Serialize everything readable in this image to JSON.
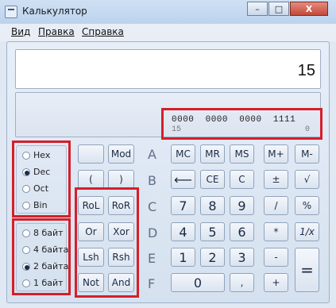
{
  "window": {
    "title": "Калькулятор",
    "buttons": {
      "minimize": "–",
      "maximize": "□",
      "close": "X"
    }
  },
  "menu": {
    "items": [
      "Вид",
      "Правка",
      "Справка"
    ]
  },
  "display": {
    "value": "15",
    "bits": {
      "row1": "0000  0000  0000  1111",
      "row2_left": "15",
      "row2_right": "0"
    }
  },
  "radix": {
    "options": [
      "Hex",
      "Dec",
      "Oct",
      "Bin"
    ],
    "selected": "Dec"
  },
  "word_size": {
    "options": [
      "8 байт",
      "4 байта",
      "2 байта",
      "1 байт"
    ],
    "selected": "2 байта"
  },
  "keys": {
    "blank": "",
    "mod": "Mod",
    "open_paren": "(",
    "close_paren": ")",
    "rol": "RoL",
    "ror": "RoR",
    "or": "Or",
    "xor": "Xor",
    "lsh": "Lsh",
    "rsh": "Rsh",
    "not": "Not",
    "and": "And",
    "hex_a": "A",
    "hex_b": "B",
    "hex_c": "C",
    "hex_d": "D",
    "hex_e": "E",
    "hex_f": "F",
    "mc": "MC",
    "mr": "MR",
    "ms": "MS",
    "mplus": "M+",
    "mminus": "M-",
    "backspace": "⟵",
    "ce": "CE",
    "c": "C",
    "plusminus": "±",
    "sqrt": "√",
    "n7": "7",
    "n8": "8",
    "n9": "9",
    "div": "/",
    "percent": "%",
    "n4": "4",
    "n5": "5",
    "n6": "6",
    "mul": "*",
    "inv": "1/x",
    "n1": "1",
    "n2": "2",
    "n3": "3",
    "sub": "-",
    "n0": "0",
    "dot": ",",
    "add": "+",
    "equals": "="
  },
  "colors": {
    "highlight": "#d4202a",
    "window_bg": "#dfe8f3"
  }
}
